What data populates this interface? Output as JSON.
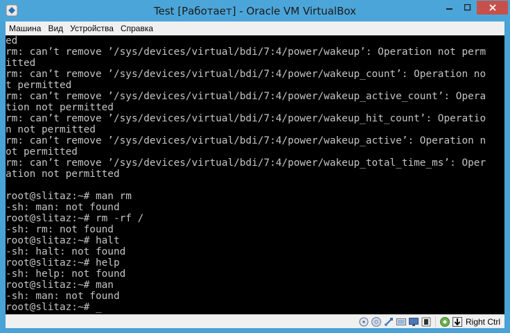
{
  "window": {
    "title": "Test [Работает] - Oracle VM VirtualBox"
  },
  "menu": [
    "Машина",
    "Вид",
    "Устройства",
    "Справка"
  ],
  "console": {
    "lines": [
      "ed",
      "rm: can’t remove ’/sys/devices/virtual/bdi/7:4/power/wakeup’: Operation not perm",
      "itted",
      "rm: can’t remove ’/sys/devices/virtual/bdi/7:4/power/wakeup_count’: Operation no",
      "t permitted",
      "rm: can’t remove ’/sys/devices/virtual/bdi/7:4/power/wakeup_active_count’: Opera",
      "tion not permitted",
      "rm: can’t remove ’/sys/devices/virtual/bdi/7:4/power/wakeup_hit_count’: Operatio",
      "n not permitted",
      "rm: can’t remove ’/sys/devices/virtual/bdi/7:4/power/wakeup_active’: Operation n",
      "ot permitted",
      "rm: can’t remove ’/sys/devices/virtual/bdi/7:4/power/wakeup_total_time_ms’: Oper",
      "ation not permitted",
      "",
      "root@slitaz:~# man rm",
      "-sh: man: not found",
      "root@slitaz:~# rm -rf /",
      "-sh: rm: not found",
      "root@slitaz:~# halt",
      "-sh: halt: not found",
      "root@slitaz:~# help",
      "-sh: help: not found",
      "root@slitaz:~# man",
      "-sh: man: not found",
      "root@slitaz:~# "
    ],
    "cursor": "_"
  },
  "status": {
    "host_key": "Right Ctrl",
    "icons": [
      "hard-disk-icon",
      "optical-drive-icon",
      "usb-icon",
      "shared-folders-icon",
      "display-icon",
      "network-icon",
      "mouse-integration-icon"
    ]
  }
}
